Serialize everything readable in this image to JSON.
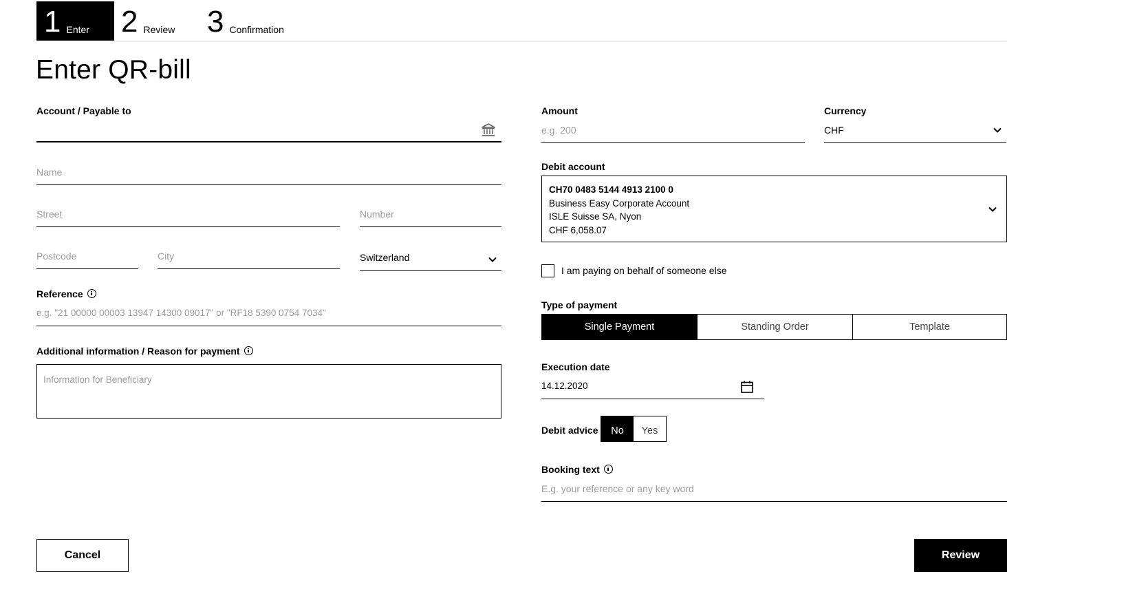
{
  "stepper": {
    "steps": [
      {
        "number": "1",
        "label": "Enter",
        "active": true
      },
      {
        "number": "2",
        "label": "Review",
        "active": false
      },
      {
        "number": "3",
        "label": "Confirmation",
        "active": false
      }
    ]
  },
  "page_title": "Enter QR-bill",
  "left": {
    "account_label": "Account / Payable to",
    "account_value": "",
    "account_icon": "bank-icon",
    "name_placeholder": "Name",
    "street_placeholder": "Street",
    "number_placeholder": "Number",
    "postcode_placeholder": "Postcode",
    "city_placeholder": "City",
    "country_value": "Switzerland",
    "reference_label": "Reference",
    "reference_placeholder": "e.g. \"21 00000 00003 13947 14300 09017\" or \"RF18 5390 0754 7034\"",
    "additional_info_label": "Additional information / Reason for payment",
    "additional_info_placeholder": "Information for Beneficiary"
  },
  "right": {
    "amount_label": "Amount",
    "amount_placeholder": "e.g. 200",
    "currency_label": "Currency",
    "currency_value": "CHF",
    "debit_account_label": "Debit account",
    "debit_account": {
      "iban": "CH70 0483 5144 4913 2100 0",
      "account_name": "Business Easy Corporate Account",
      "holder": "ISLE Suisse SA, Nyon",
      "balance": "CHF 6,058.07"
    },
    "behalf_checkbox_label": "I am paying on behalf of someone else",
    "behalf_checked": false,
    "type_of_payment_label": "Type of payment",
    "payment_types": [
      {
        "label": "Single Payment",
        "selected": true
      },
      {
        "label": "Standing Order",
        "selected": false
      },
      {
        "label": "Template",
        "selected": false
      }
    ],
    "execution_date_label": "Execution date",
    "execution_date_value": "14.12.2020",
    "debit_advice_label": "Debit advice",
    "debit_advice_options": [
      {
        "label": "No",
        "selected": true
      },
      {
        "label": "Yes",
        "selected": false
      }
    ],
    "booking_text_label": "Booking text",
    "booking_text_placeholder": "E.g. your reference or any key word"
  },
  "actions": {
    "cancel_label": "Cancel",
    "review_label": "Review"
  },
  "colors": {
    "primary": "#000000",
    "placeholder": "#9c9c9c",
    "background": "#ffffff"
  }
}
